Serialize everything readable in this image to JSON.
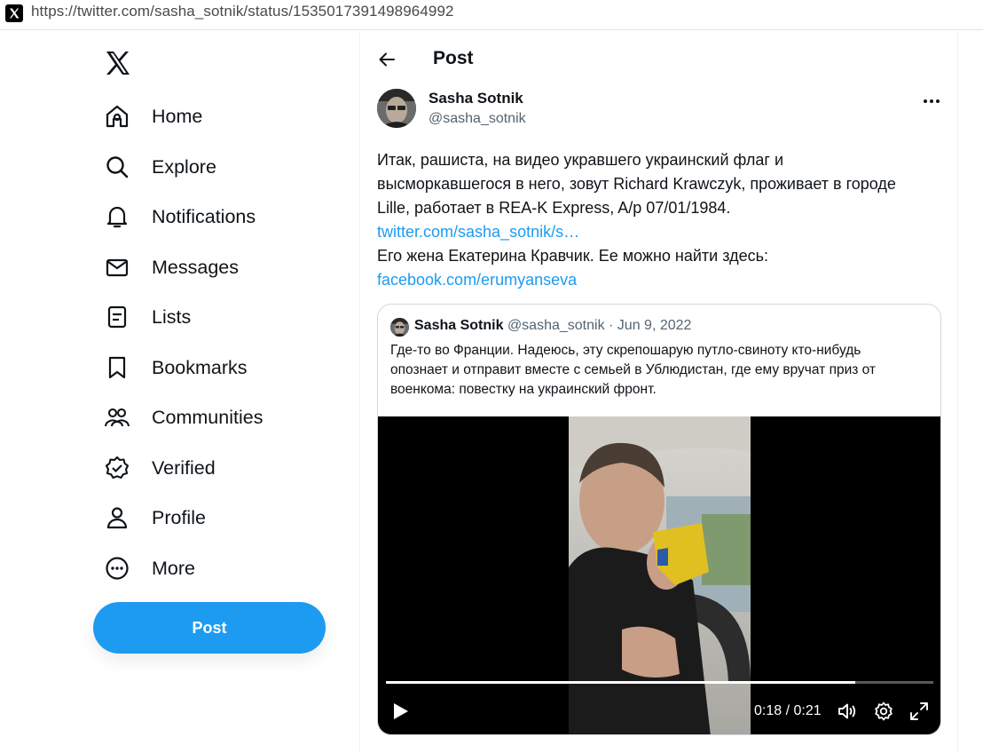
{
  "browser": {
    "url": "https://twitter.com/sasha_sotnik/status/1535017391498964992"
  },
  "sidebar": {
    "logo_icon": "x-logo-icon",
    "items": [
      {
        "label": "Home",
        "icon": "home-icon"
      },
      {
        "label": "Explore",
        "icon": "search-icon"
      },
      {
        "label": "Notifications",
        "icon": "bell-icon"
      },
      {
        "label": "Messages",
        "icon": "envelope-icon"
      },
      {
        "label": "Lists",
        "icon": "list-icon"
      },
      {
        "label": "Bookmarks",
        "icon": "bookmark-icon"
      },
      {
        "label": "Communities",
        "icon": "people-icon"
      },
      {
        "label": "Verified",
        "icon": "verified-badge-icon"
      },
      {
        "label": "Profile",
        "icon": "person-icon"
      },
      {
        "label": "More",
        "icon": "more-circle-icon"
      }
    ],
    "post_button": "Post"
  },
  "header": {
    "title": "Post"
  },
  "tweet": {
    "author_name": "Sasha Sotnik",
    "author_handle": "@sasha_sotnik",
    "text_lines": [
      "Итак, рашиста, на видео укравшего украинский флаг и",
      "высморкавшегося в него, зовут Richard Krawczyk, проживает в городе",
      "Lille, работает в REA-K Express, A/p 07/01/1984.",
      "twitter.com/sasha_sotnik/s…",
      "Его жена Екатерина Кравчик. Ее можно найти здесь:",
      "facebook.com/erumyanseva"
    ]
  },
  "quote": {
    "author_name": "Sasha Sotnik",
    "author_handle": "@sasha_sotnik",
    "separator": " · ",
    "date": "Jun 9, 2022",
    "text_lines": [
      "Где-то во Франции. Надеюсь, эту скрепошарую путло-свиноту кто-нибудь",
      "опознает и отправит вместе с семьей в Ублюдистан, где ему вручат приз от",
      "военкома: повестку на украинский фронт."
    ]
  },
  "video": {
    "time": "0:18 / 0:21",
    "progress": 0.8571
  },
  "colors": {
    "accent": "#1d9bf0",
    "text": "#0f1419",
    "muted": "#536471",
    "border": "#cfd9de"
  }
}
